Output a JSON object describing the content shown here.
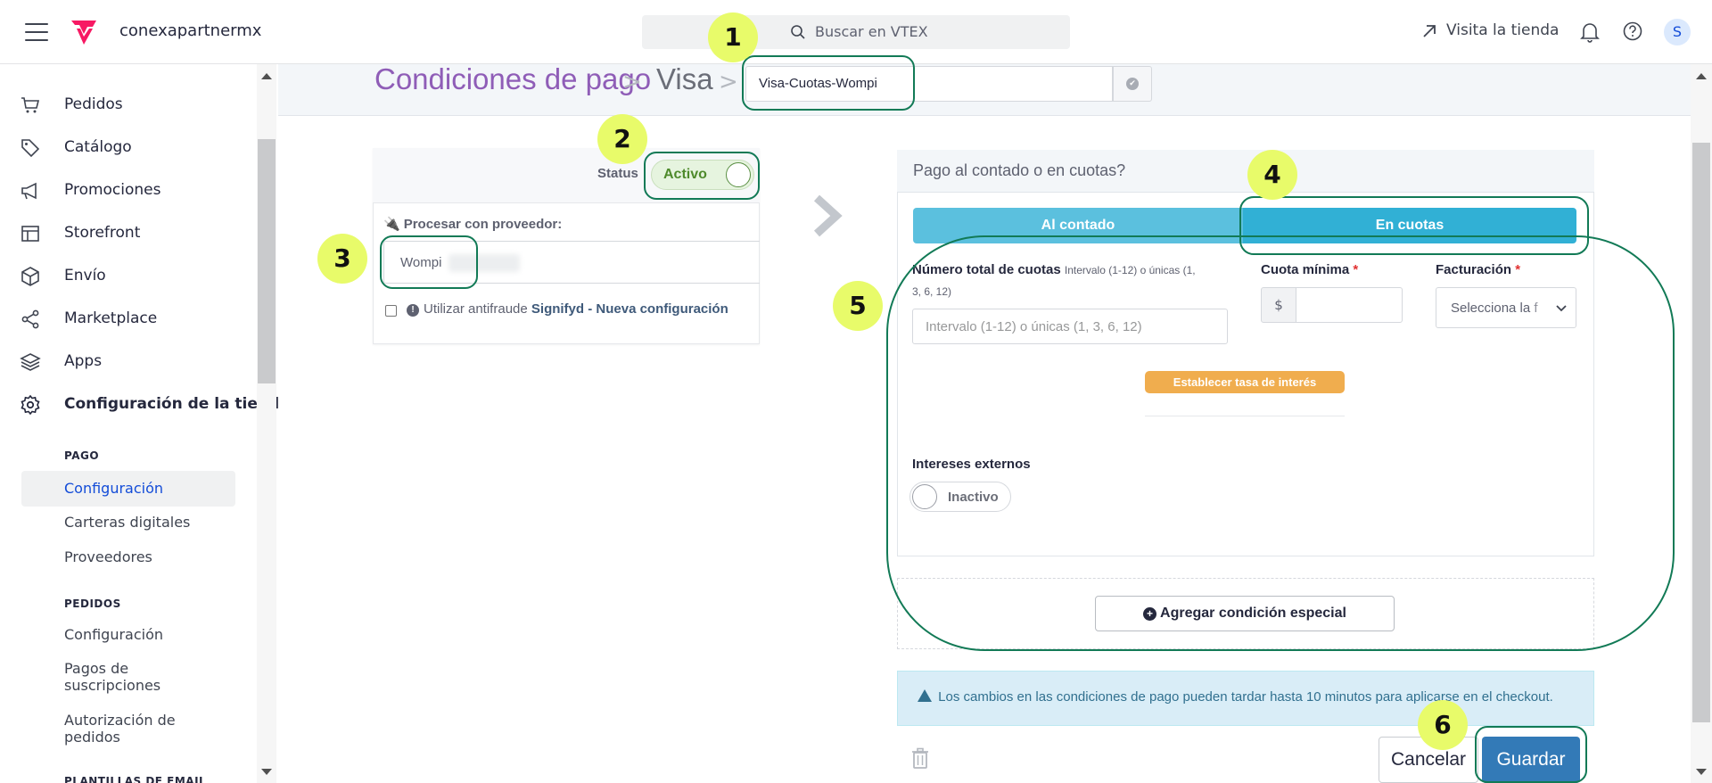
{
  "topbar": {
    "account": "conexapartnermx",
    "search_placeholder": "Buscar en VTEX",
    "visit_store": "Visita la tienda",
    "avatar_initial": "S"
  },
  "sidebar": {
    "items": [
      {
        "label": "Pedidos",
        "icon": "cart-icon"
      },
      {
        "label": "Catálogo",
        "icon": "tag-icon"
      },
      {
        "label": "Promociones",
        "icon": "megaphone-icon"
      },
      {
        "label": "Storefront",
        "icon": "layout-icon"
      },
      {
        "label": "Envío",
        "icon": "box-icon"
      },
      {
        "label": "Marketplace",
        "icon": "share-icon"
      },
      {
        "label": "Apps",
        "icon": "layers-icon"
      },
      {
        "label": "Configuración de la tienda",
        "icon": "gear-icon"
      }
    ],
    "section_pago": "PAGO",
    "pago_items": [
      "Configuración",
      "Carteras digitales",
      "Proveedores"
    ],
    "section_pedidos": "PEDIDOS",
    "pedidos_items": [
      "Configuración",
      "Pagos de suscripciones",
      "Autorización de pedidos"
    ],
    "section_plantillas": "PLANTILLAS DE EMAIL"
  },
  "breadcrumb": {
    "title": "Condiciones de pago",
    "separator": ">",
    "current": "Visa",
    "name_value": "Visa-Cuotas-Wompi"
  },
  "left_card": {
    "status_label": "Status",
    "status_value": "Activo",
    "provider_label": "Procesar con proveedor:",
    "provider_value": "Wompi",
    "antifraud_text": "Utilizar antifraude",
    "antifraud_link": "Signifyd - Nueva configuración"
  },
  "panel": {
    "title": "Pago al contado o en cuotas?",
    "tab_contado": "Al contado",
    "tab_cuotas": "En cuotas",
    "installments_label": "Número total de cuotas",
    "installments_hint_a": "Intervalo (1-12) o únicas (1,",
    "installments_hint_b": "3, 6, 12)",
    "installments_placeholder": "Intervalo (1-12) o únicas (1, 3, 6, 12)",
    "min_quota_label": "Cuota mínima",
    "currency_symbol": "$",
    "billing_label": "Facturación",
    "billing_placeholder": "Selecciona la f",
    "interest_button": "Establecer tasa de interés",
    "external_interest_label": "Intereses externos",
    "external_interest_value": "Inactivo",
    "required_mark": "*"
  },
  "special_condition": "Agregar condición especial",
  "alert": "Los cambios en las condiciones de pago pueden tardar hasta 10 minutos para aplicarse en el checkout.",
  "actions": {
    "cancel": "Cancelar",
    "save": "Guardar"
  },
  "annotations": [
    "1",
    "2",
    "3",
    "4",
    "5",
    "6"
  ],
  "colors": {
    "brand": "#f71963",
    "title_purple": "#8f5db7",
    "annotation_fill": "#e8fb6a",
    "annotation_stroke": "#127a56",
    "primary_button": "#337ab7"
  }
}
